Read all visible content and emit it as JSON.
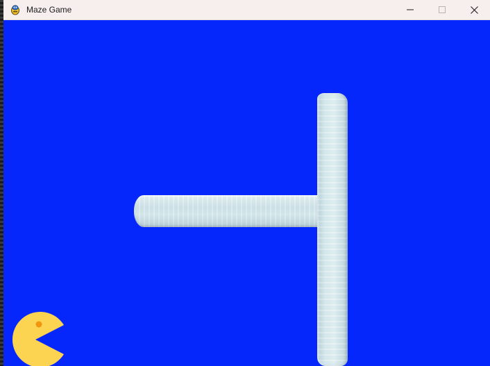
{
  "window": {
    "title": "Maze Game",
    "controls": {
      "minimize": "minimize",
      "maximize": "maximize",
      "close": "close"
    }
  },
  "game": {
    "background_color": "#0527fc",
    "wall_color": "#d8e9ec",
    "player_color": "#fdd352",
    "player_eye_color": "#f0960f",
    "walls": [
      "horizontal-wall",
      "vertical-wall"
    ],
    "player": "pacman"
  }
}
